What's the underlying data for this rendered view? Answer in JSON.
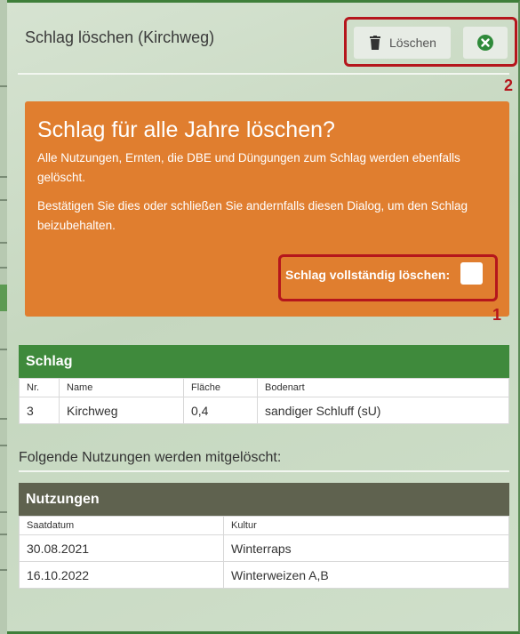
{
  "dialog": {
    "title": "Schlag löschen (Kirchweg)",
    "delete_label": "Löschen"
  },
  "warning": {
    "heading": "Schlag für alle Jahre löschen?",
    "text1": "Alle Nutzungen, Ernten, die DBE und Düngungen zum Schlag werden ebenfalls gelöscht.",
    "text2": "Bestätigen Sie dies oder schließen Sie andernfalls diesen Dialog, um den Schlag beizubehalten.",
    "confirm_label": "Schlag vollständig löschen:"
  },
  "callouts": [
    "1",
    "2"
  ],
  "schlag_table": {
    "title": "Schlag",
    "headers": [
      "Nr.",
      "Name",
      "Fläche",
      "Bodenart"
    ],
    "rows": [
      [
        "3",
        "Kirchweg",
        "0,4",
        "sandiger Schluff (sU)"
      ]
    ]
  },
  "section_title": "Folgende Nutzungen werden mitgelöscht:",
  "nutzungen_table": {
    "title": "Nutzungen",
    "headers": [
      "Saatdatum",
      "Kultur"
    ],
    "rows": [
      [
        "30.08.2021",
        "Winterraps"
      ],
      [
        "16.10.2022",
        "Winterweizen A,B"
      ]
    ]
  },
  "colors": {
    "warning": "#e07e2f",
    "schlag_header": "#3f8a3c",
    "nutzungen_header": "#5f624f",
    "callout": "#b5161c",
    "close_icon": "#2f8a3a"
  },
  "icons": {
    "delete": "trash-icon",
    "close": "close-circle-icon"
  }
}
